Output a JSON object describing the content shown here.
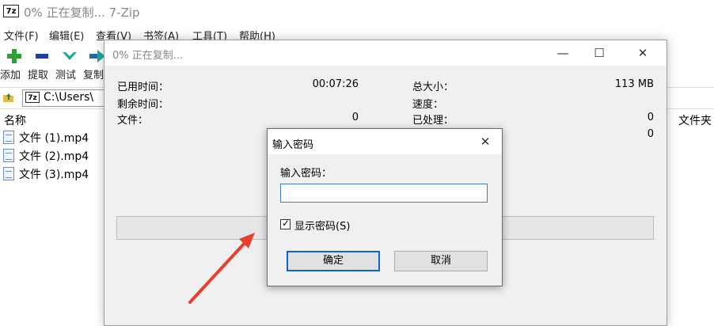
{
  "app": {
    "title": "0% 正在复制... 7-Zip",
    "icon_text": "7z"
  },
  "menu": [
    "文件(F)",
    "编辑(E)",
    "查看(V)",
    "书签(A)",
    "工具(T)",
    "帮助(H)"
  ],
  "toolbar": {
    "add_label": "添加",
    "extract_label": "提取",
    "test_label": "测试",
    "copy_label": "复制"
  },
  "address": {
    "icon_text": "7z",
    "path": "C:\\Users\\"
  },
  "columns": {
    "name": "名称",
    "folder": "文件夹"
  },
  "files": [
    "文件 (1).mp4",
    "文件 (2).mp4",
    "文件 (3).mp4"
  ],
  "progress_dialog": {
    "title": "0% 正在复制...",
    "minimize": "—",
    "maximize": "☐",
    "close": "✕",
    "elapsed_label": "已用时间：",
    "elapsed_value": "00:07:26",
    "remaining_label": "剩余时间：",
    "files_label": "文件：",
    "files_value": "0",
    "total_size_label": "总大小：",
    "total_size_value": "113 MB",
    "speed_label": "速度：",
    "processed_label": "已处理：",
    "processed_value": "0",
    "compressed_value": "0"
  },
  "password_dialog": {
    "title": "输入密码",
    "close": "✕",
    "prompt": "输入密码：",
    "password_value": "",
    "show_password_label": "显示密码(S)",
    "show_password_checked": "✓",
    "ok_label": "确定",
    "cancel_label": "取消"
  },
  "colors": {
    "accent": "#0a64d6",
    "annotation_arrow": "#e8402e"
  }
}
